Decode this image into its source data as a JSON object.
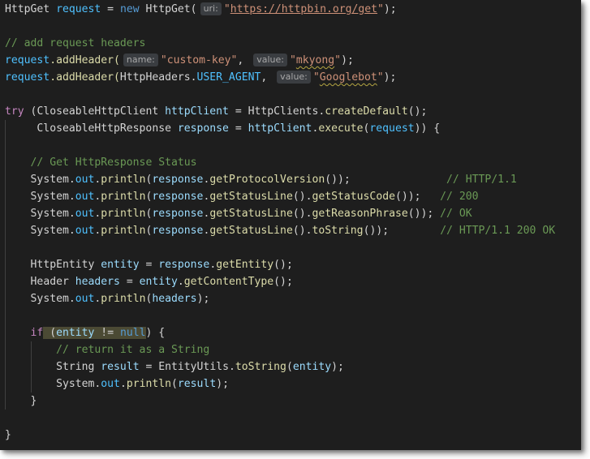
{
  "editor": {
    "background": "#1e1e1e",
    "lines": {
      "l1": {
        "t1": "HttpGet",
        "t2": "request",
        "t3": "=",
        "t4": "new",
        "t5": "HttpGet(",
        "hint": "uri:",
        "q1": "\"",
        "url": "https://httpbin.org/get",
        "q2": "\"",
        "t6": ");"
      },
      "l3": {
        "cm": "// add request headers"
      },
      "l4": {
        "v": "request",
        "f": ".addHeader(",
        "h1": "name:",
        "s1": "\"custom-key\"",
        "c": ", ",
        "h2": "value:",
        "s2a": "\"",
        "s2b": "mkyong",
        "s2c": "\"",
        "e": ");"
      },
      "l5": {
        "v": "request",
        "f": ".addHeader(",
        "cls": "HttpHeaders",
        "dot": ".",
        "const": "USER_AGENT",
        "c": ", ",
        "h": "value:",
        "s1": "\"",
        "s2": "Googlebot",
        "s3": "\"",
        "e": ");"
      },
      "l7": {
        "kw": "try",
        "p1": " (",
        "ty": "CloseableHttpClient",
        "v": "httpClient",
        "eq": " = ",
        "cls": "HttpClients",
        "dot": ".",
        "f": "createDefault",
        "e": "();"
      },
      "l8": {
        "ty": "CloseableHttpResponse",
        "v": "response",
        "eq": " = ",
        "v2": "httpClient",
        "dot": ".",
        "f": "execute",
        "p1": "(",
        "v3": "request",
        "e": ")) {"
      },
      "l10": {
        "cm": "// Get HttpResponse Status"
      },
      "l11": {
        "sys": "System",
        "out": "out",
        "pr": "println",
        "v": "response",
        "f": "getProtocolVersion",
        "e": "());",
        "cm": "// HTTP/1.1"
      },
      "l12": {
        "sys": "System",
        "out": "out",
        "pr": "println",
        "v": "response",
        "f1": "getStatusLine",
        "f2": "getStatusCode",
        "e": "());",
        "cm": "// 200"
      },
      "l13": {
        "sys": "System",
        "out": "out",
        "pr": "println",
        "v": "response",
        "f1": "getStatusLine",
        "f2": "getReasonPhrase",
        "e": "());",
        "cm": "// OK"
      },
      "l14": {
        "sys": "System",
        "out": "out",
        "pr": "println",
        "v": "response",
        "f1": "getStatusLine",
        "f2": "toString",
        "e": "());",
        "cm": "// HTTP/1.1 200 OK"
      },
      "l16": {
        "ty": "HttpEntity",
        "v": "entity",
        "v2": "response",
        "f": "getEntity",
        "e": "();"
      },
      "l17": {
        "ty": "Header",
        "v": "headers",
        "v2": "entity",
        "f": "getContentType",
        "e": "();"
      },
      "l18": {
        "sys": "System",
        "out": "out",
        "pr": "println",
        "v": "headers",
        "e": ");"
      },
      "l20": {
        "kw": "if",
        "p1": " (",
        "v": "entity",
        "op": " != ",
        "nul": "null",
        "e": ") {"
      },
      "l21": {
        "cm": "// return it as a String"
      },
      "l22": {
        "ty": "String",
        "v": "result",
        "cls": "EntityUtils",
        "f": "toString",
        "v2": "entity",
        "e": ");"
      },
      "l23": {
        "sys": "System",
        "out": "out",
        "pr": "println",
        "v": "result",
        "e": ");"
      },
      "l24": {
        "b": "}"
      },
      "l26": {
        "b": "}"
      }
    }
  }
}
